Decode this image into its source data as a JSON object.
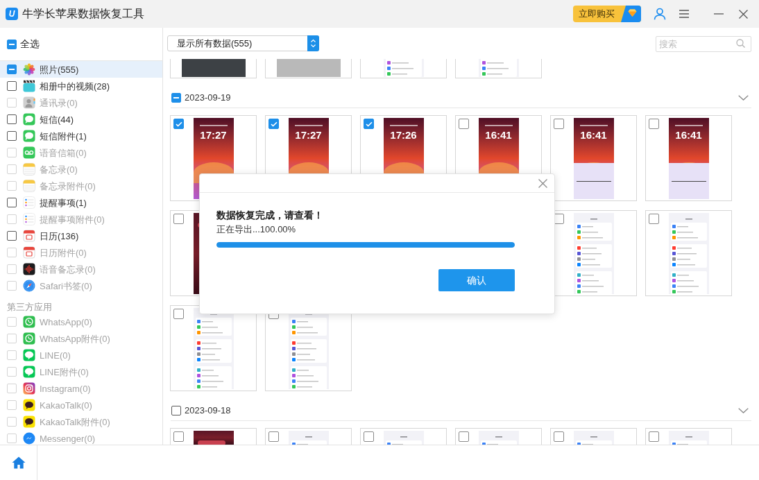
{
  "window": {
    "logo": "U",
    "title": "牛学长苹果数据恢复工具",
    "buy_button": "立即购买"
  },
  "sidebar": {
    "select_all": {
      "label": "全选",
      "checked": false,
      "partial": true
    },
    "items": [
      {
        "kind": "photos",
        "label": "照片(555)",
        "checked": false,
        "partial": true,
        "disabled": false,
        "selected": true
      },
      {
        "kind": "video",
        "label": "相册中的视频(28)",
        "checked": false,
        "partial": false,
        "disabled": false,
        "selected": false
      },
      {
        "kind": "contacts",
        "label": "通讯录(0)",
        "checked": false,
        "partial": false,
        "disabled": true,
        "selected": false
      },
      {
        "kind": "messages",
        "label": "短信(44)",
        "checked": false,
        "partial": false,
        "disabled": false,
        "selected": false
      },
      {
        "kind": "messages",
        "label": "短信附件(1)",
        "checked": false,
        "partial": false,
        "disabled": false,
        "selected": false
      },
      {
        "kind": "voicemail",
        "label": "语音信箱(0)",
        "checked": false,
        "partial": false,
        "disabled": true,
        "selected": false
      },
      {
        "kind": "notes",
        "label": "备忘录(0)",
        "checked": false,
        "partial": false,
        "disabled": true,
        "selected": false
      },
      {
        "kind": "notes",
        "label": "备忘录附件(0)",
        "checked": false,
        "partial": false,
        "disabled": true,
        "selected": false
      },
      {
        "kind": "reminders",
        "label": "提醒事项(1)",
        "checked": false,
        "partial": false,
        "disabled": false,
        "selected": false
      },
      {
        "kind": "reminders",
        "label": "提醒事项附件(0)",
        "checked": false,
        "partial": false,
        "disabled": true,
        "selected": false
      },
      {
        "kind": "calendar",
        "label": "日历(136)",
        "checked": false,
        "partial": false,
        "disabled": false,
        "selected": false
      },
      {
        "kind": "calendar",
        "label": "日历附件(0)",
        "checked": false,
        "partial": false,
        "disabled": true,
        "selected": false
      },
      {
        "kind": "voice_memos",
        "label": "语音备忘录(0)",
        "checked": false,
        "partial": false,
        "disabled": true,
        "selected": false
      },
      {
        "kind": "safari",
        "label": "Safari书签(0)",
        "checked": false,
        "partial": false,
        "disabled": true,
        "selected": false
      }
    ],
    "section_title": "第三方应用",
    "third_party_items": [
      {
        "kind": "whatsapp",
        "label": "WhatsApp(0)",
        "checked": false,
        "partial": false,
        "disabled": true,
        "selected": false
      },
      {
        "kind": "whatsapp",
        "label": "WhatsApp附件(0)",
        "checked": false,
        "partial": false,
        "disabled": true,
        "selected": false
      },
      {
        "kind": "line",
        "label": "LINE(0)",
        "checked": false,
        "partial": false,
        "disabled": true,
        "selected": false
      },
      {
        "kind": "line",
        "label": "LINE附件(0)",
        "checked": false,
        "partial": false,
        "disabled": true,
        "selected": false
      },
      {
        "kind": "instagram",
        "label": "Instagram(0)",
        "checked": false,
        "partial": false,
        "disabled": true,
        "selected": false
      },
      {
        "kind": "kakaotalk",
        "label": "KakaoTalk(0)",
        "checked": false,
        "partial": false,
        "disabled": true,
        "selected": false
      },
      {
        "kind": "kakaotalk",
        "label": "KakaoTalk附件(0)",
        "checked": false,
        "partial": false,
        "disabled": true,
        "selected": false
      },
      {
        "kind": "messenger",
        "label": "Messenger(0)",
        "checked": false,
        "partial": false,
        "disabled": true,
        "selected": false
      }
    ]
  },
  "toolbar": {
    "filter": "显示所有数据(555)",
    "search": {
      "placeholder": "搜索"
    }
  },
  "top_row": [
    {
      "kind": "photo_dark"
    },
    {
      "kind": "photo_light"
    },
    {
      "kind": "settings"
    },
    {
      "kind": "settings"
    }
  ],
  "groups": [
    {
      "date": "2023-09-19",
      "checked": false,
      "partial": true,
      "cards": [
        {
          "kind": "lockscreen",
          "checked": true,
          "time": "17:27"
        },
        {
          "kind": "lockscreen",
          "checked": true,
          "time": "17:27"
        },
        {
          "kind": "lockscreen",
          "checked": true,
          "time": "17:26"
        },
        {
          "kind": "lockscreen",
          "checked": false,
          "time": "16:41"
        },
        {
          "kind": "lockscreen_panel",
          "checked": false,
          "time": "16:41"
        },
        {
          "kind": "lockscreen_panel",
          "checked": false,
          "time": "16:41"
        },
        {
          "kind": "wallpaper",
          "checked": false
        },
        {
          "kind": "covered"
        },
        {
          "kind": "covered"
        },
        {
          "kind": "covered"
        },
        {
          "kind": "settings",
          "checked": false
        },
        {
          "kind": "settings",
          "checked": false
        },
        {
          "kind": "settings",
          "checked": false
        },
        {
          "kind": "settings",
          "checked": false
        }
      ]
    },
    {
      "date": "2023-09-18",
      "checked": false,
      "partial": false,
      "cards": [
        {
          "kind": "wallpaper",
          "checked": false
        },
        {
          "kind": "settings",
          "checked": false
        },
        {
          "kind": "settings",
          "checked": false
        },
        {
          "kind": "settings",
          "checked": false
        },
        {
          "kind": "settings",
          "checked": false
        },
        {
          "kind": "settings",
          "checked": false
        }
      ]
    }
  ],
  "dialog": {
    "title": "数据恢复完成，请查看！",
    "status": "正在导出...100.00%",
    "progress": {
      "level": 1
    },
    "button": "确认"
  }
}
